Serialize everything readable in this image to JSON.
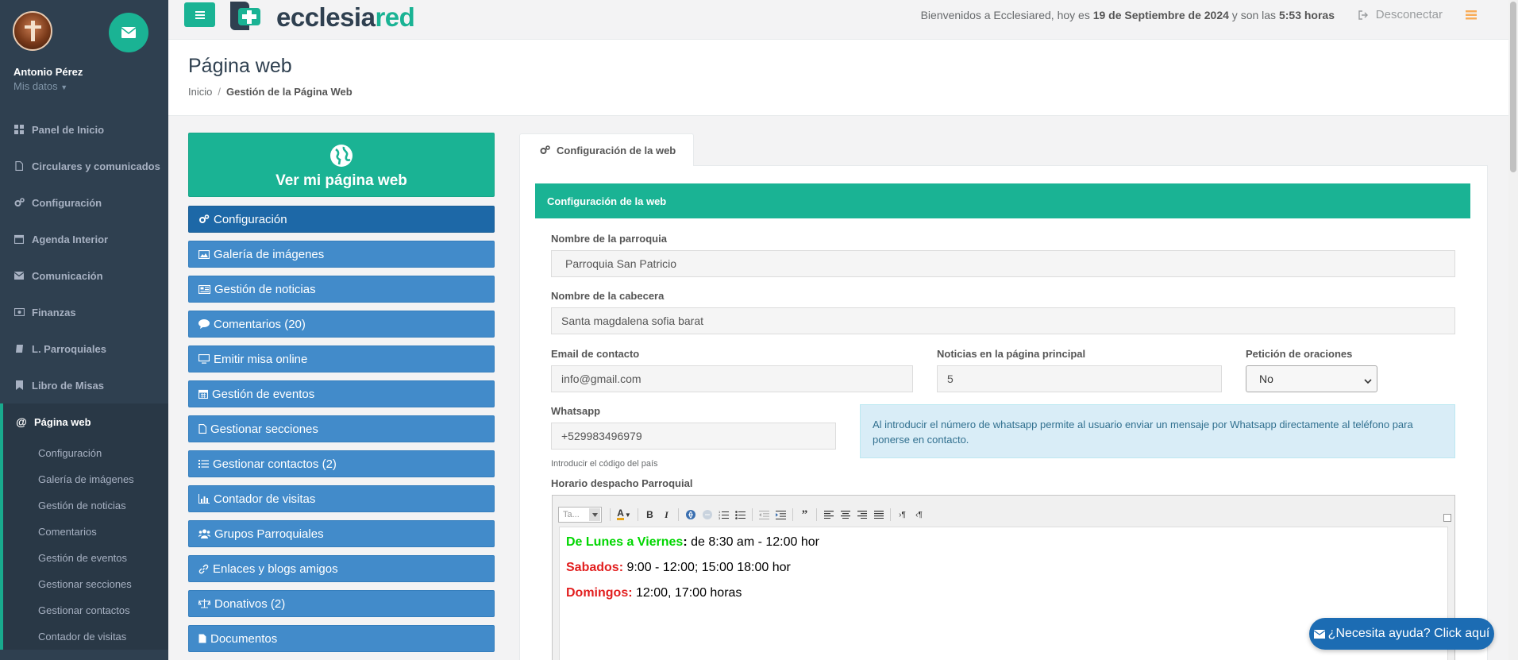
{
  "user": {
    "name": "Antonio Pérez",
    "sub": "Mis datos"
  },
  "nav": [
    {
      "label": "Panel de Inicio",
      "icon": "grid-icon"
    },
    {
      "label": "Circulares y comunicados",
      "icon": "document-icon"
    },
    {
      "label": "Configuración",
      "icon": "cogs-icon"
    },
    {
      "label": "Agenda Interior",
      "icon": "calendar-icon"
    },
    {
      "label": "Comunicación",
      "icon": "envelope-icon"
    },
    {
      "label": "Finanzas",
      "icon": "money-icon"
    },
    {
      "label": "L. Parroquiales",
      "icon": "book-icon"
    },
    {
      "label": "Libro de Misas",
      "icon": "bookmark-icon"
    },
    {
      "label": "Página web",
      "icon": "at-icon"
    }
  ],
  "subnav": [
    "Configuración",
    "Galería de imágenes",
    "Gestión de noticias",
    "Comentarios",
    "Gestión de eventos",
    "Gestionar secciones",
    "Gestionar contactos",
    "Contador de visitas"
  ],
  "topbar": {
    "logo_a": "ecclesia",
    "logo_b": "red",
    "welcome_pre": "Bienvenidos a Ecclesiared, hoy es ",
    "date": "19 de Septiembre de 2024",
    "welcome_mid": " y son las ",
    "time": "5:53 horas",
    "logout": "Desconectar"
  },
  "heading": {
    "title": "Página web",
    "crumb_home": "Inicio",
    "crumb_sep": "/",
    "crumb_current": "Gestión de la Página Web"
  },
  "webbox": {
    "label": "Ver mi página web"
  },
  "menu": [
    {
      "label": "Configuración",
      "icon": "cogs-icon"
    },
    {
      "label": "Galería de imágenes",
      "icon": "picture-icon"
    },
    {
      "label": "Gestión de noticias",
      "icon": "newspaper-icon"
    },
    {
      "label": "Comentarios (20)",
      "icon": "comment-icon"
    },
    {
      "label": "Emitir misa online",
      "icon": "desktop-icon"
    },
    {
      "label": "Gestión de eventos",
      "icon": "calendar-icon"
    },
    {
      "label": "Gestionar secciones",
      "icon": "file-icon"
    },
    {
      "label": "Gestionar contactos (2)",
      "icon": "list-icon"
    },
    {
      "label": "Contador de visitas",
      "icon": "bar-chart-icon"
    },
    {
      "label": "Grupos Parroquiales",
      "icon": "users-icon"
    },
    {
      "label": "Enlaces y blogs amigos",
      "icon": "link-icon"
    },
    {
      "label": "Donativos (2)",
      "icon": "balance-icon"
    },
    {
      "label": "Documentos",
      "icon": "file-icon"
    }
  ],
  "tab": {
    "label": "Configuración de la web"
  },
  "form": {
    "section_title": "Configuración de la web",
    "parroquia_label": "Nombre de la parroquia",
    "parroquia_value": "Parroquia San Patricio",
    "cabecera_label": "Nombre de la cabecera",
    "cabecera_value": "Santa magdalena sofia barat",
    "email_label": "Email de contacto",
    "email_value": "info@gmail.com",
    "noticias_label": "Noticias en la página principal",
    "noticias_value": "5",
    "oraciones_label": "Petición de oraciones",
    "oraciones_value": "No",
    "whatsapp_label": "Whatsapp",
    "whatsapp_value": "+529983496979",
    "whatsapp_help": "Introducir el código del país",
    "whatsapp_info": "Al introducir el número de whatsapp permite al usuario enviar un mensaje por Whatsapp directamente al teléfono para ponerse en contacto.",
    "horario_label": "Horario despacho Parroquial"
  },
  "editor": {
    "combo_placeholder": "Ta...",
    "line1_label": "De Lunes a Viernes",
    "line1_sep": ":",
    "line1_text": " de 8:30 am - 12:00 hor",
    "line2_label": "Sabados:",
    "line2_text": " 9:00 - 12:00; 15:00 18:00  hor",
    "line3_label": "Domingos:",
    "line3_text": " 12:00, 17:00  horas"
  },
  "help_button": {
    "label": "¿Necesita ayuda? Click aquí"
  },
  "colors": {
    "primary": "#1ab394",
    "sidebar": "#2f4050",
    "menu_button": "#428bca",
    "menu_active": "#1d68a7",
    "help_button": "#1c6cb3"
  }
}
